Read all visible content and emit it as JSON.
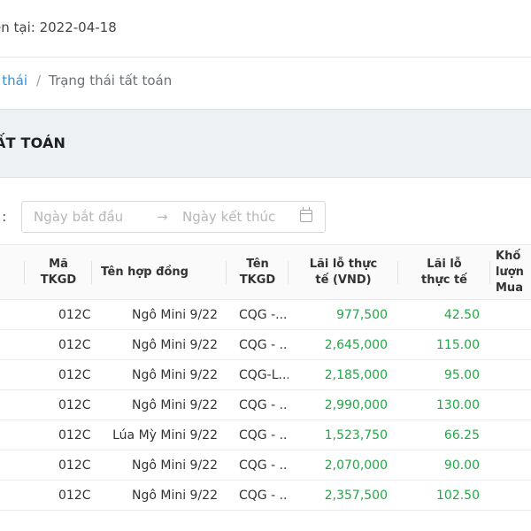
{
  "header": {
    "session_date_text": "ện tại: 2022-04-18"
  },
  "breadcrumb": {
    "parent": "g thái",
    "separator": "/",
    "current": "Trạng thái tất toán"
  },
  "section": {
    "title": "ẤT TOÁN"
  },
  "filter": {
    "label": "p :",
    "start_placeholder": "Ngày bắt đầu",
    "arrow": "→",
    "end_placeholder": "Ngày kết thúc"
  },
  "table": {
    "headers": {
      "code": "Mã\nTKGD",
      "contract": "Tên hợp đồng",
      "tkgd_name": "Tên\nTKGD",
      "pnl_vnd": "Lãi lỗ thực\ntế (VND)",
      "pnl": "Lãi lỗ\nthực tế",
      "volume": "Khố\nlượn\nMua"
    },
    "rows": [
      {
        "code": "012C...",
        "contract": "Ngô Mini 9/22",
        "tkgd": "CQG -...",
        "pnl_vnd": "977,500",
        "pnl": "42.50"
      },
      {
        "code": "012C...",
        "contract": "Ngô Mini 9/22",
        "tkgd": "CQG - ...",
        "pnl_vnd": "2,645,000",
        "pnl": "115.00"
      },
      {
        "code": "012C...",
        "contract": "Ngô Mini 9/22",
        "tkgd": "CQG-L...",
        "pnl_vnd": "2,185,000",
        "pnl": "95.00"
      },
      {
        "code": "012C...",
        "contract": "Ngô Mini 9/22",
        "tkgd": "CQG - ...",
        "pnl_vnd": "2,990,000",
        "pnl": "130.00"
      },
      {
        "code": "012C...",
        "contract": "Lúa Mỳ Mini 9/22",
        "tkgd": "CQG - ...",
        "pnl_vnd": "1,523,750",
        "pnl": "66.25"
      },
      {
        "code": "012C...",
        "contract": "Ngô Mini 9/22",
        "tkgd": "CQG - ...",
        "pnl_vnd": "2,070,000",
        "pnl": "90.00"
      },
      {
        "code": "012C...",
        "contract": "Ngô Mini 9/22",
        "tkgd": "CQG - ...",
        "pnl_vnd": "2,357,500",
        "pnl": "102.50"
      }
    ]
  },
  "colors": {
    "link": "#3c8fd6",
    "positive": "#22a846",
    "band": "#eef1f4"
  },
  "icons": {
    "date_picker": "calendar-icon"
  }
}
